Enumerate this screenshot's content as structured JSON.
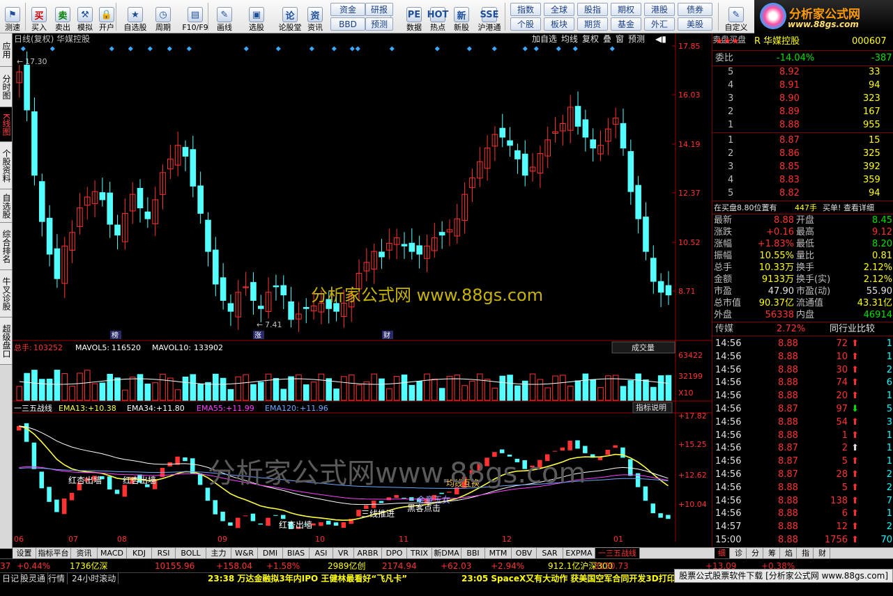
{
  "toolbar": {
    "buttons": [
      {
        "name": "test",
        "label": "测速",
        "glyph": "⚑"
      },
      {
        "name": "buy",
        "label": "买入",
        "glyph": "买"
      },
      {
        "name": "sell",
        "label": "卖出",
        "glyph": "卖"
      },
      {
        "name": "simulate",
        "label": "模拟",
        "glyph": "⚒"
      },
      {
        "name": "open-account",
        "label": "开户",
        "glyph": "🔒"
      },
      {
        "name": "watchlist",
        "label": "自选股",
        "glyph": "★"
      },
      {
        "name": "period",
        "label": "周期",
        "glyph": "◷"
      },
      {
        "name": "f10",
        "label": "F10/F9",
        "glyph": "▤"
      },
      {
        "name": "draw",
        "label": "画线",
        "glyph": "✎"
      },
      {
        "name": "pick",
        "label": "选股",
        "glyph": "▣"
      },
      {
        "name": "forum",
        "label": "论股堂",
        "glyph": "论"
      },
      {
        "name": "info",
        "label": "资讯",
        "glyph": "资"
      },
      {
        "name": "data",
        "label": "数据",
        "glyph": "PE"
      },
      {
        "name": "hot",
        "label": "热点",
        "glyph": "HOT"
      },
      {
        "name": "ipo",
        "label": "新股",
        "glyph": "新"
      },
      {
        "name": "hk-connect",
        "label": "沪港通",
        "glyph": "SSE"
      },
      {
        "name": "custom",
        "label": "自定义",
        "glyph": "✎"
      }
    ],
    "small_buttons": {
      "funds": "资金",
      "research": "研报",
      "bbd": "BBD",
      "forecast": "预测",
      "index": "指数",
      "global": "全球",
      "stock_index": "股指",
      "futures": "期权",
      "hk": "港股",
      "bonds": "债券",
      "individual": "个股",
      "sector": "板块",
      "future2": "期货",
      "fund": "基金",
      "fx": "外汇",
      "us": "美股"
    }
  },
  "logo": {
    "title": "分析家公式网",
    "url": "www.88gs.com"
  },
  "left_tabs": [
    "应用",
    "分时图",
    "K线图",
    "个股资料",
    "自选股",
    "综合排名",
    "牛叉诊股",
    "超级盘口"
  ],
  "chart": {
    "title": "日线(复权) 华媒控股",
    "top_buttons": [
      "加自选",
      "均线",
      "复权",
      "叠",
      "窗",
      "预测"
    ],
    "price_axis": [
      "17.85",
      "16.03",
      "14.19",
      "12.37",
      "10.52",
      "8.71"
    ],
    "high_label": "17.30",
    "low_label": "7.41",
    "markers": [
      "榜",
      "涨",
      "财"
    ],
    "watermark1": "分析家公式网 www.88gs.com",
    "watermark2": "分析家公式网www.88gs.com",
    "volume": {
      "total_label": "总手:",
      "total": "103252",
      "ma5_label": "MAVOL5:",
      "ma5": "116520",
      "ma10_label": "MAVOL10:",
      "ma10": "133902",
      "button": "成交量",
      "axis": [
        "63422",
        "32199",
        "X10"
      ]
    },
    "indicator": {
      "name": "一三五战线",
      "ema13_label": "EMA13:",
      "ema13": "+10.38",
      "ema34_label": "EMA34:",
      "ema34": "+11.80",
      "ema55_label": "EMA55:",
      "ema55": "+11.99",
      "ema120_label": "EMA120:",
      "ema120": "+11.96",
      "button": "指标说明",
      "axis": [
        "+17.82",
        "+15.25",
        "+12.62",
        "+10.04"
      ],
      "annotations": [
        "红杏出墙",
        "红杏出墙",
        "红杏出墙",
        "三线推进",
        "黑客点击",
        "金童玉女",
        "均线互换"
      ]
    },
    "months": [
      "06",
      "07",
      "08",
      "09",
      "10",
      "11",
      "12",
      "01"
    ],
    "series_colors": {
      "up": "#ff3232",
      "down": "#54ffff",
      "ema13": "#ffff40",
      "ema34": "#ffffff",
      "ema55": "#ff40ff",
      "ema120": "#6fa8ff"
    }
  },
  "chart_data": {
    "type": "candlestick",
    "title": "日线(复权) 华媒控股",
    "x_categories": [
      "06",
      "07",
      "08",
      "09",
      "10",
      "11",
      "12",
      "01"
    ],
    "ylim": [
      7.41,
      17.85
    ],
    "close": [
      17.0,
      15.6,
      13.2,
      11.5,
      10.3,
      9.4,
      10.6,
      11.1,
      12.0,
      12.4,
      12.6,
      12.3,
      11.4,
      11.0,
      11.8,
      12.5,
      12.0,
      11.6,
      12.3,
      13.3,
      13.8,
      14.3,
      13.9,
      12.8,
      11.8,
      10.4,
      9.2,
      8.6,
      8.2,
      8.9,
      9.1,
      8.6,
      8.3,
      8.9,
      9.1,
      8.8,
      7.9,
      8.1,
      8.3,
      8.4,
      8.5,
      8.3,
      8.2,
      8.5,
      8.8,
      9.6,
      10.0,
      10.4,
      10.2,
      10.7,
      10.9,
      10.6,
      10.4,
      10.3,
      10.6,
      10.9,
      11.0,
      11.2,
      11.6,
      12.5,
      13.1,
      13.7,
      14.2,
      14.7,
      14.6,
      14.3,
      13.8,
      13.2,
      13.5,
      14.0,
      14.5,
      14.8,
      15.1,
      15.7,
      15.0,
      14.6,
      14.2,
      14.3,
      14.9,
      15.3,
      14.2,
      12.6,
      11.6,
      10.4,
      9.3,
      8.9,
      8.8
    ],
    "volume_axis": [
      63422,
      32199
    ],
    "volume_stats": {
      "total": 103252,
      "mavol5": 116520,
      "mavol10": 133902
    },
    "indicator": {
      "ema13": 10.38,
      "ema34": 11.8,
      "ema55": 11.99,
      "ema120": 11.96,
      "axis": [
        17.82,
        15.25,
        12.62,
        10.04
      ]
    }
  },
  "quote": {
    "stars": "★★★",
    "name": "R 华媒控股",
    "code": "000607",
    "weibi_label": "委比",
    "weibi": "-14.04%",
    "weicha": "-387",
    "sell_label": [
      "卖",
      "盘"
    ],
    "buy_label": [
      "买",
      "盘"
    ],
    "asks": [
      {
        "lv": "5",
        "p": "8.92",
        "v": "33"
      },
      {
        "lv": "4",
        "p": "8.91",
        "v": "94"
      },
      {
        "lv": "3",
        "p": "8.90",
        "v": "323"
      },
      {
        "lv": "2",
        "p": "8.89",
        "v": "167"
      },
      {
        "lv": "1",
        "p": "8.88",
        "v": "955"
      }
    ],
    "bids": [
      {
        "lv": "1",
        "p": "8.87",
        "v": "15"
      },
      {
        "lv": "2",
        "p": "8.86",
        "v": "325"
      },
      {
        "lv": "3",
        "p": "8.85",
        "v": "392"
      },
      {
        "lv": "4",
        "p": "8.83",
        "v": "359"
      },
      {
        "lv": "5",
        "p": "8.82",
        "v": "94"
      }
    ],
    "notice": "在买盘8.80位置有",
    "notice_vol": "447手",
    "notice_act": "买单!",
    "notice_link": "查看详细",
    "stats": [
      {
        "l1": "最新",
        "v1": "8.88",
        "c1": "red",
        "l2": "开盘",
        "v2": "8.45",
        "c2": "grn"
      },
      {
        "l1": "涨跌",
        "v1": "+0.16",
        "c1": "red",
        "l2": "最高",
        "v2": "9.12",
        "c2": "red"
      },
      {
        "l1": "涨幅",
        "v1": "+1.83%",
        "c1": "red",
        "l2": "最低",
        "v2": "8.20",
        "c2": "grn"
      },
      {
        "l1": "振幅",
        "v1": "10.55%",
        "c1": "yel",
        "l2": "量比",
        "v2": "0.81",
        "c2": "yel"
      },
      {
        "l1": "总手",
        "v1": "10.33万",
        "c1": "yel",
        "l2": "换手",
        "v2": "2.12%",
        "c2": "yel"
      },
      {
        "l1": "金额",
        "v1": "9133万",
        "c1": "yel",
        "l2": "换手(实)",
        "v2": "2.12%",
        "c2": "yel"
      },
      {
        "l1": "市盈",
        "v1": "47.90",
        "c1": "wht",
        "l2": "市盈(动)",
        "v2": "55.90",
        "c2": "wht"
      },
      {
        "l1": "总市值",
        "v1": "90.37亿",
        "c1": "yel",
        "l2": "流通值",
        "v2": "43.31亿",
        "c2": "yel"
      },
      {
        "l1": "外盘",
        "v1": "56338",
        "c1": "red",
        "l2": "内盘",
        "v2": "46914",
        "c2": "grn"
      }
    ],
    "sector_label": "传媒",
    "sector_pct": "2.72%",
    "sector_btn": "同行业比较",
    "ticks": [
      {
        "t": "14:56",
        "p": "8.88",
        "v": "72",
        "d": "up",
        "n": "1"
      },
      {
        "t": "14:56",
        "p": "8.88",
        "v": "10",
        "d": "up",
        "n": "1"
      },
      {
        "t": "14:56",
        "p": "8.88",
        "v": "30",
        "d": "up",
        "n": "2"
      },
      {
        "t": "14:56",
        "p": "8.88",
        "v": "74",
        "d": "up",
        "n": "6"
      },
      {
        "t": "14:56",
        "p": "8.88",
        "v": "20",
        "d": "up",
        "n": "1"
      },
      {
        "t": "14:56",
        "p": "8.87",
        "v": "97",
        "d": "down",
        "n": "5"
      },
      {
        "t": "14:56",
        "p": "8.88",
        "v": "54",
        "d": "up",
        "n": "3"
      },
      {
        "t": "14:56",
        "p": "8.88",
        "v": "1",
        "d": "up",
        "n": "1"
      },
      {
        "t": "14:56",
        "p": "8.87",
        "v": "2",
        "d": "upw",
        "n": "1"
      },
      {
        "t": "14:56",
        "p": "8.87",
        "v": "5",
        "d": "up",
        "n": "1"
      },
      {
        "t": "14:56",
        "p": "8.87",
        "v": "28",
        "d": "up",
        "n": "2"
      },
      {
        "t": "14:56",
        "p": "8.88",
        "v": "5",
        "d": "up",
        "n": "2"
      },
      {
        "t": "14:56",
        "p": "8.88",
        "v": "138",
        "d": "up",
        "n": "7"
      },
      {
        "t": "14:56",
        "p": "8.88",
        "v": "6",
        "d": "up",
        "n": "1"
      },
      {
        "t": "14:57",
        "p": "8.88",
        "v": "12",
        "d": "up",
        "n": "2"
      },
      {
        "t": "15:00",
        "p": "8.88",
        "v": "1756",
        "d": "up",
        "n": "70"
      }
    ],
    "right_tabs": [
      "细",
      "诊",
      "分",
      "筹",
      "焰",
      "指",
      "财"
    ]
  },
  "bottom_tabs": [
    "设置",
    "指标平台",
    "资讯",
    "MACD",
    "KDJ",
    "RSI",
    "BOLL",
    "主力",
    "W&R",
    "DMI",
    "BIAS",
    "ASI",
    "VR",
    "ARBR",
    "DPO",
    "TRIX",
    "新DMA",
    "BBI",
    "MTM",
    "OBV",
    "SAR",
    "EXPMA",
    "一三五战线"
  ],
  "status_bar": {
    "items": [
      {
        "t": "37",
        "c": "red"
      },
      {
        "t": "+0.44%",
        "c": "red"
      },
      {
        "t": "1736亿深",
        "c": "yel"
      },
      {
        "t": "10155.96",
        "c": "red"
      },
      {
        "t": "+158.04",
        "c": "red"
      },
      {
        "t": "+1.58%",
        "c": "red"
      },
      {
        "t": "2989亿创",
        "c": "yel"
      },
      {
        "t": "2174.94",
        "c": "red"
      },
      {
        "t": "+62.03",
        "c": "red"
      },
      {
        "t": "+2.94%",
        "c": "red"
      },
      {
        "t": "912.1亿沪深300",
        "c": "yel"
      },
      {
        "t": "3130.73",
        "c": "red"
      },
      {
        "t": "+13.09",
        "c": "red"
      },
      {
        "t": "+0.38%",
        "c": "red"
      }
    ]
  },
  "ticker": {
    "labels": [
      "日记",
      "股灵通",
      "行情",
      "24小时滚动"
    ],
    "news1": "23:38 万达金融拟3年内IPO 王健林最看好“飞凡卡”",
    "news2": "23:05 SpaceX又有大动作 获美国空军合同开发3D打印火箭",
    "download": "股票公式股票软件下载 [分析家公式网 www.88gs.com]"
  }
}
